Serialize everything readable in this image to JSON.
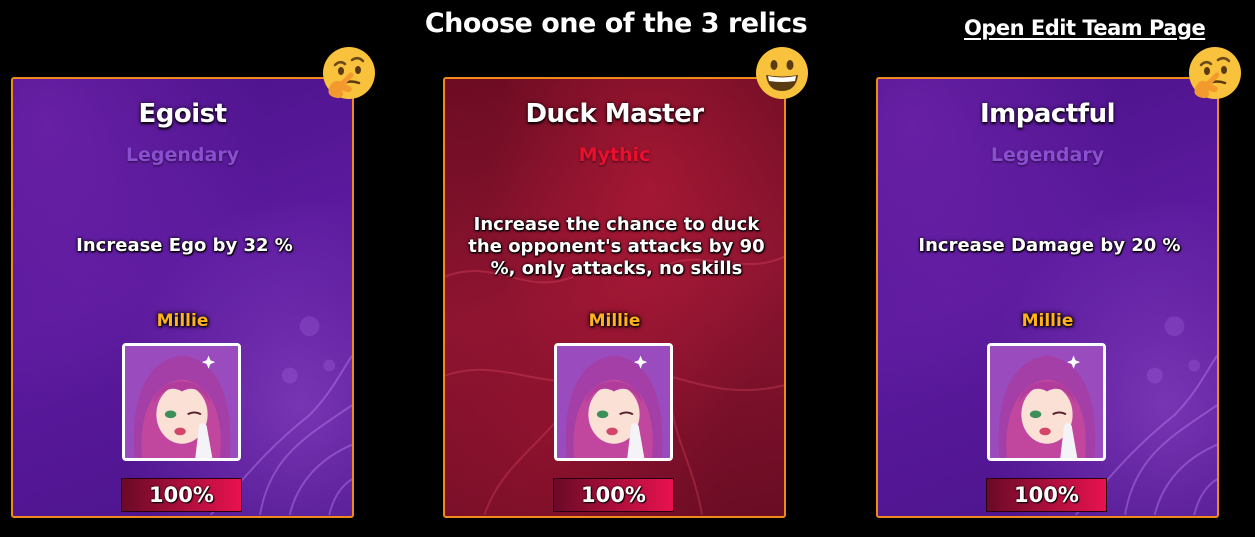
{
  "header": {
    "title": "Choose one of the 3 relics",
    "edit_link": "Open Edit Team Page"
  },
  "colors": {
    "card_border": "#f08a1c",
    "legendary": "#8a4fd0",
    "mythic": "#e8102e",
    "hero_name": "#ffb21c",
    "progress_fill": "#d0104a"
  },
  "cards": [
    {
      "title": "Egoist",
      "rarity": "Legendary",
      "rarity_color": "#8a4fd0",
      "description": "Increase Ego by 32 %",
      "hero": "Millie",
      "progress_label": "100%",
      "progress": 1.0,
      "reaction_icon": "thinking-face-emoji"
    },
    {
      "title": "Duck Master",
      "rarity": "Mythic",
      "rarity_color": "#e8102e",
      "description_lines": [
        "Increase the chance to duck",
        "the opponent's attacks by 90",
        "%, only attacks, no skills"
      ],
      "hero": "Millie",
      "progress_label": "100%",
      "progress": 1.0,
      "reaction_icon": "grinning-face-emoji"
    },
    {
      "title": "Impactful",
      "rarity": "Legendary",
      "rarity_color": "#8a4fd0",
      "description": "Increase Damage by 20 %",
      "hero": "Millie",
      "progress_label": "100%",
      "progress": 1.0,
      "reaction_icon": "thinking-face-emoji"
    }
  ]
}
